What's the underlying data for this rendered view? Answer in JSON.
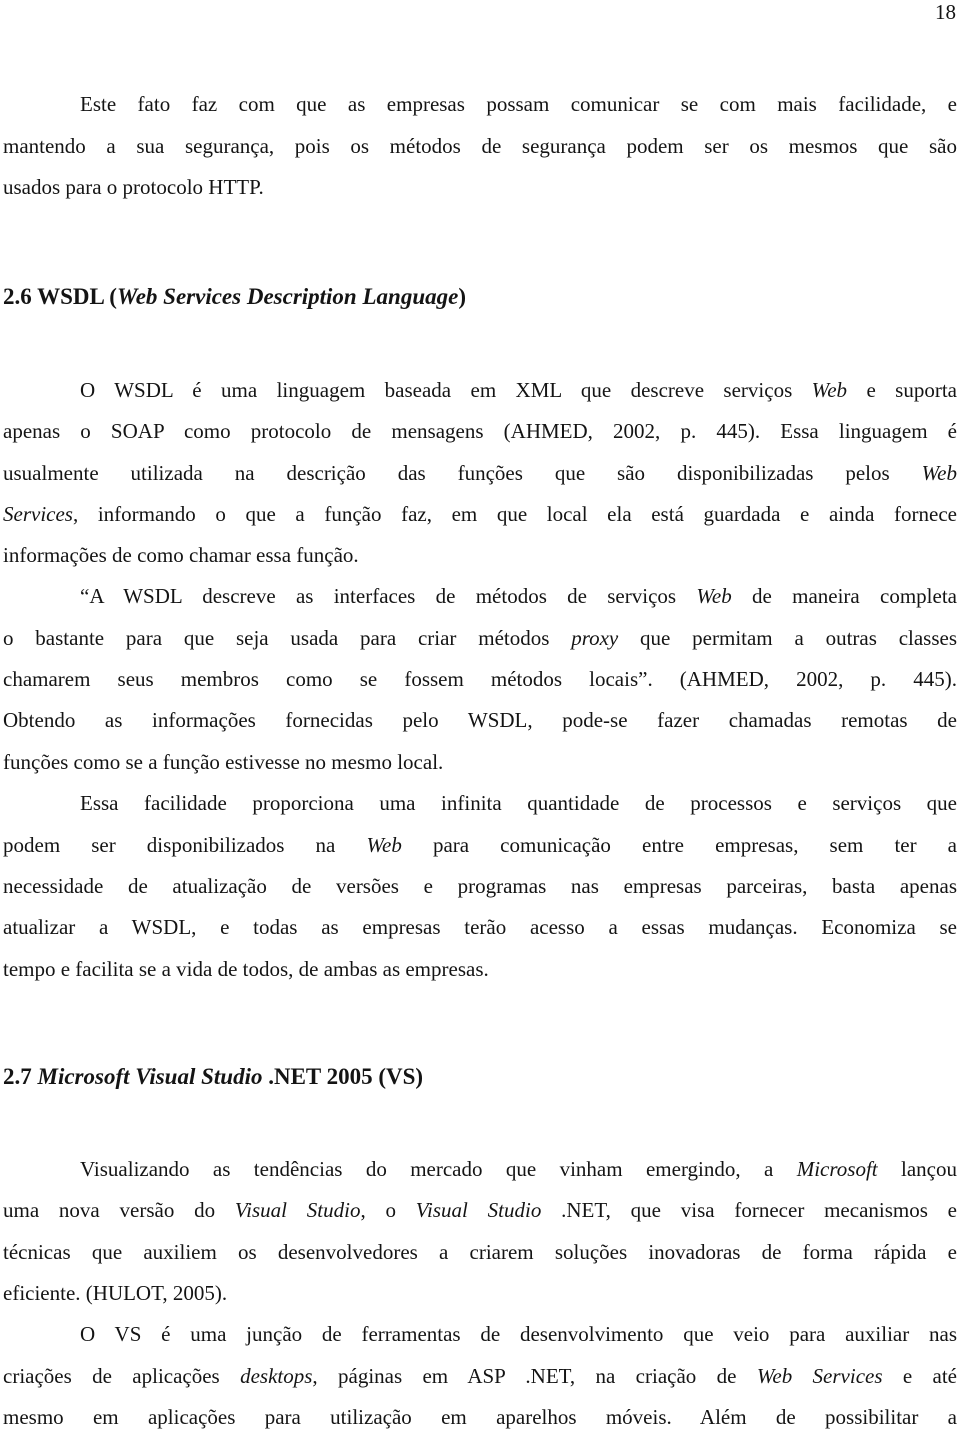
{
  "page_number": "18",
  "sections": {
    "intro": {
      "lines": [
        [
          {
            "t": "Este fato faz com que as empresas possam comunicar se com mais facilidade, e"
          }
        ],
        [
          {
            "t": "mantendo a sua segurança, pois os métodos de segurança podem ser os mesmos que são"
          }
        ],
        [
          {
            "t": "usados para o protocolo HTTP."
          }
        ]
      ]
    },
    "s26": {
      "heading": [
        {
          "t": "2.6 WSDL ("
        },
        {
          "t": "Web Services Description Language",
          "i": true
        },
        {
          "t": ")"
        }
      ],
      "lines": [
        [
          {
            "t": "O WSDL é uma linguagem baseada em XML que descreve serviços "
          },
          {
            "t": "Web",
            "i": true
          },
          {
            "t": " e suporta"
          }
        ],
        [
          {
            "t": "apenas o SOAP como protocolo de mensagens (AHMED, 2002, p. 445). Essa linguagem é"
          }
        ],
        [
          {
            "t": "usualmente utilizada na descrição das funções que são disponibilizadas pelos "
          },
          {
            "t": "Web",
            "i": true
          }
        ],
        [
          {
            "t": "Services",
            "i": true
          },
          {
            "t": ", informando o que a função faz, em que local ela está guardada e ainda fornece"
          }
        ],
        [
          {
            "t": "informações de como chamar essa função."
          }
        ],
        [
          {
            "t": "“A WSDL descreve as interfaces de métodos de serviços "
          },
          {
            "t": "Web",
            "i": true
          },
          {
            "t": " de maneira completa"
          }
        ],
        [
          {
            "t": "o bastante para que seja usada para criar métodos "
          },
          {
            "t": "proxy",
            "i": true
          },
          {
            "t": " que permitam a outras classes"
          }
        ],
        [
          {
            "t": "chamarem seus membros como se fossem métodos locais”. (AHMED, 2002, p. 445)."
          }
        ],
        [
          {
            "t": "Obtendo as informações fornecidas pelo WSDL, pode-se fazer chamadas remotas de"
          }
        ],
        [
          {
            "t": "funções como se a função estivesse no mesmo local."
          }
        ],
        [
          {
            "t": "Essa facilidade proporciona uma infinita quantidade de processos e serviços que"
          }
        ],
        [
          {
            "t": "podem ser disponibilizados na "
          },
          {
            "t": "Web",
            "i": true
          },
          {
            "t": " para comunicação entre empresas, sem ter a"
          }
        ],
        [
          {
            "t": "necessidade de atualização de versões e programas nas empresas parceiras, basta apenas"
          }
        ],
        [
          {
            "t": "atualizar a WSDL, e todas as empresas terão acesso a essas mudanças. Economiza se"
          }
        ],
        [
          {
            "t": "tempo e facilita se a vida de todos, de ambas as empresas."
          }
        ]
      ]
    },
    "s27": {
      "heading": [
        {
          "t": "2.7 "
        },
        {
          "t": "Microsoft Visual Studio",
          "i": true
        },
        {
          "t": " .NET 2005 (VS)"
        }
      ],
      "lines": [
        [
          {
            "t": "Visualizando as tendências do mercado que vinham emergindo, a "
          },
          {
            "t": "Microsoft",
            "i": true
          },
          {
            "t": " lançou"
          }
        ],
        [
          {
            "t": "uma nova versão do "
          },
          {
            "t": "Visual Studio",
            "i": true
          },
          {
            "t": ", o "
          },
          {
            "t": "Visual Studio",
            "i": true
          },
          {
            "t": " .NET, que visa fornecer mecanismos e"
          }
        ],
        [
          {
            "t": "técnicas que auxiliem os desenvolvedores a criarem soluções inovadoras de forma rápida e"
          }
        ],
        [
          {
            "t": "eficiente. (HULOT, 2005)."
          }
        ],
        [
          {
            "t": "O VS é uma junção de ferramentas de desenvolvimento que veio para auxiliar nas"
          }
        ],
        [
          {
            "t": "criações de aplicações "
          },
          {
            "t": "desktops",
            "i": true
          },
          {
            "t": ", páginas em ASP .NET, na criação de "
          },
          {
            "t": "Web Services",
            "i": true
          },
          {
            "t": " e até"
          }
        ],
        [
          {
            "t": "mesmo em aplicações para utilização em aparelhos móveis. Além de possibilitar a"
          }
        ]
      ]
    }
  }
}
